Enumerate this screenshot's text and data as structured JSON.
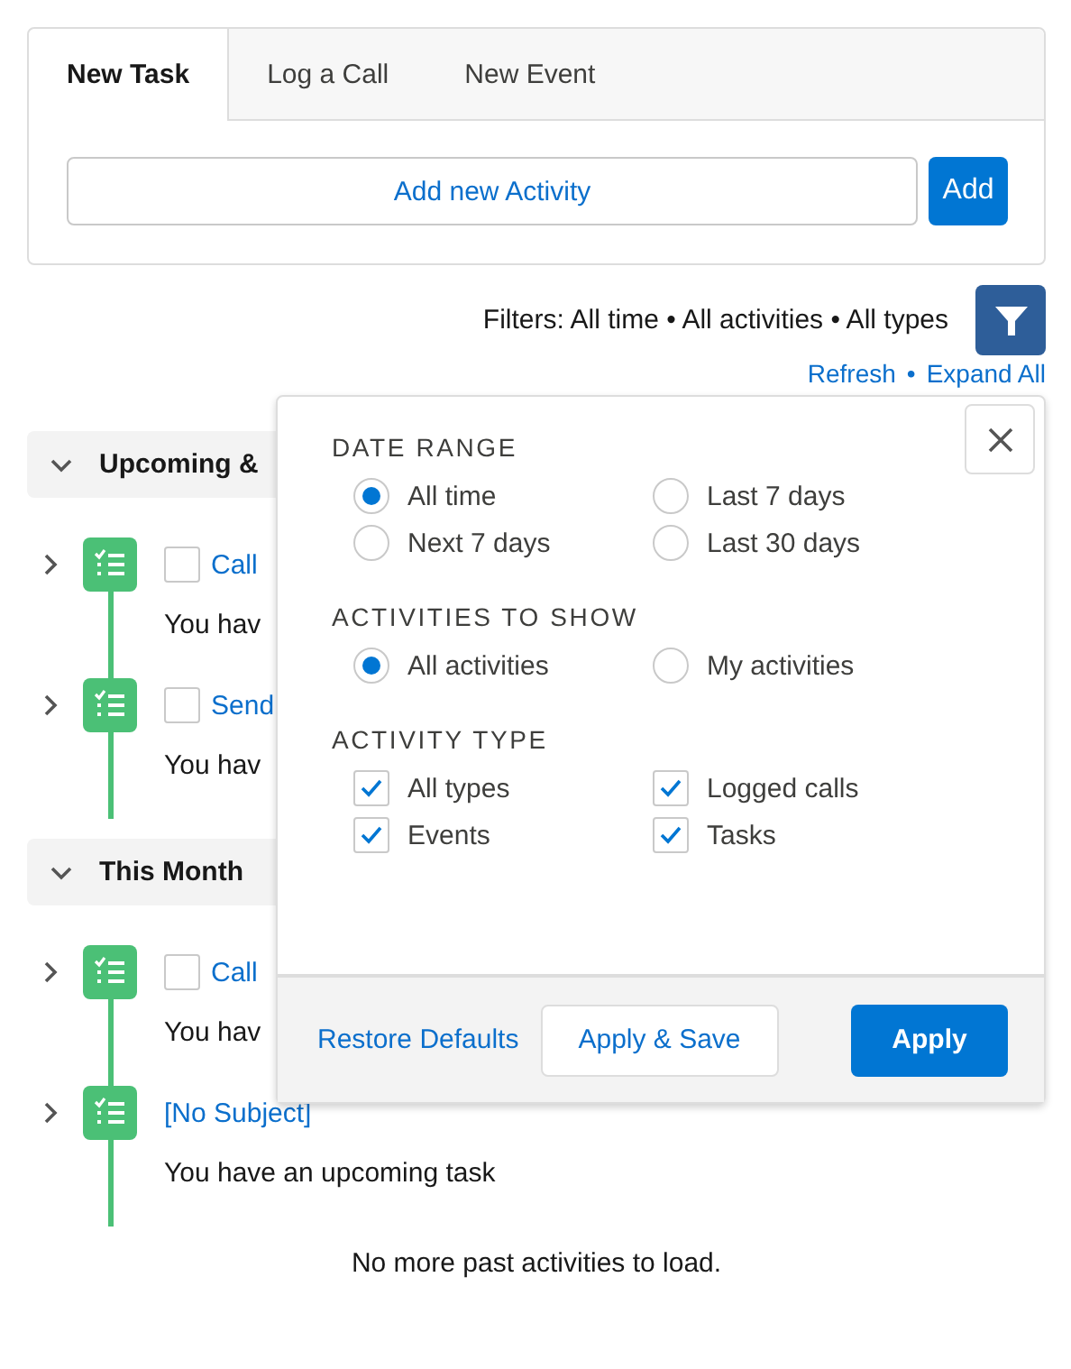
{
  "composer": {
    "tabs": [
      {
        "label": "New Task",
        "selected": true
      },
      {
        "label": "Log a Call",
        "selected": false
      },
      {
        "label": "New Event",
        "selected": false
      }
    ],
    "input": {
      "placeholder": "Add new Activity"
    },
    "add_button": "Add"
  },
  "filters": {
    "summary": "Filters: All time • All activities • All types",
    "links": [
      "Refresh",
      "Expand All"
    ],
    "separator": "•"
  },
  "sections": [
    {
      "title": "Upcoming &",
      "expanded": true,
      "items": [
        {
          "subject": "Call",
          "checked": false,
          "description": "You hav"
        },
        {
          "subject": "Send",
          "checked": false,
          "description": "You hav"
        }
      ]
    },
    {
      "title": "This Month",
      "expanded": true,
      "items": [
        {
          "subject": "Call",
          "checked": false,
          "description": "You hav"
        },
        {
          "subject": "[No Subject]",
          "description": "You have an upcoming task"
        }
      ]
    }
  ],
  "footer_note": "No more past activities to load.",
  "filter_popover": {
    "groups": [
      {
        "title": "DATE RANGE",
        "kind": "radio",
        "options": [
          {
            "label": "All time",
            "selected": true
          },
          {
            "label": "Last 7 days",
            "selected": false
          },
          {
            "label": "Next 7 days",
            "selected": false
          },
          {
            "label": "Last 30 days",
            "selected": false
          }
        ]
      },
      {
        "title": "ACTIVITIES TO SHOW",
        "kind": "radio",
        "options": [
          {
            "label": "All activities",
            "selected": true
          },
          {
            "label": "My activities",
            "selected": false
          }
        ]
      },
      {
        "title": "ACTIVITY TYPE",
        "kind": "checkbox",
        "options": [
          {
            "label": "All types",
            "checked": true
          },
          {
            "label": "Logged calls",
            "checked": true
          },
          {
            "label": "Events",
            "checked": true
          },
          {
            "label": "Tasks",
            "checked": true
          }
        ]
      }
    ],
    "buttons": {
      "restore": "Restore Defaults",
      "apply_save": "Apply & Save",
      "apply": "Apply"
    }
  }
}
